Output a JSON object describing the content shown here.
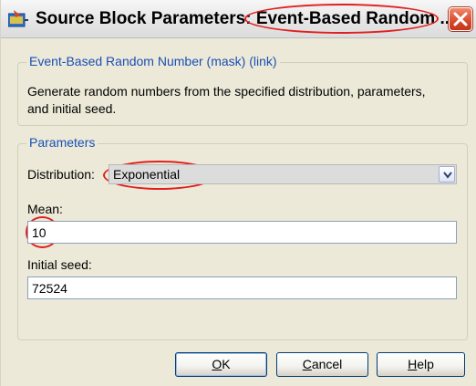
{
  "window": {
    "title": "Source Block Parameters: Event-Based Random ...",
    "close_label": "Close"
  },
  "mask_group": {
    "legend": "Event-Based Random Number (mask) (link)",
    "description": "Generate random numbers from the specified distribution, parameters, and initial seed."
  },
  "parameters": {
    "legend": "Parameters",
    "distribution_label": "Distribution:",
    "distribution_value": "Exponential",
    "mean_label": "Mean:",
    "mean_value": "10",
    "seed_label": "Initial seed:",
    "seed_value": "72524"
  },
  "buttons": {
    "ok": {
      "first": "O",
      "rest": "K"
    },
    "cancel": {
      "first": "C",
      "rest": "ancel"
    },
    "help": {
      "first": "H",
      "rest": "elp"
    }
  },
  "colors": {
    "accent": "#1a4fb5",
    "callout": "#e02020",
    "dialog_bg": "#ece9d8"
  },
  "icons": {
    "title_icon": "simulink-block-icon",
    "close_icon": "close-icon",
    "dropdown_icon": "chevron-down-icon"
  }
}
